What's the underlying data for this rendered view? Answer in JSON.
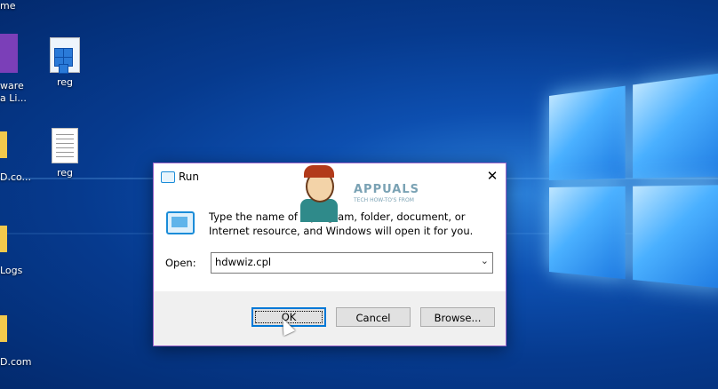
{
  "desktop": {
    "icons": [
      {
        "label": "reg",
        "type": "registry"
      },
      {
        "label": "reg",
        "type": "document"
      }
    ],
    "left_edge_labels": [
      "me",
      "ware",
      "a Li...",
      "D.co...",
      "Logs",
      "D.com"
    ]
  },
  "run_dialog": {
    "title": "Run",
    "close_glyph": "✕",
    "description": "Type the name of a program, folder, document, or Internet resource, and Windows will open it for you.",
    "open_label": "Open:",
    "open_value": "hdwwiz.cpl",
    "buttons": {
      "ok": "OK",
      "cancel": "Cancel",
      "browse": "Browse..."
    }
  },
  "watermark": {
    "text": "APPUALS",
    "subtext": "TECH HOW-TO'S FROM"
  },
  "colors": {
    "accent": "#0078d7",
    "dialog_border": "#9a63c9",
    "desktop": "#0a4aa8"
  }
}
